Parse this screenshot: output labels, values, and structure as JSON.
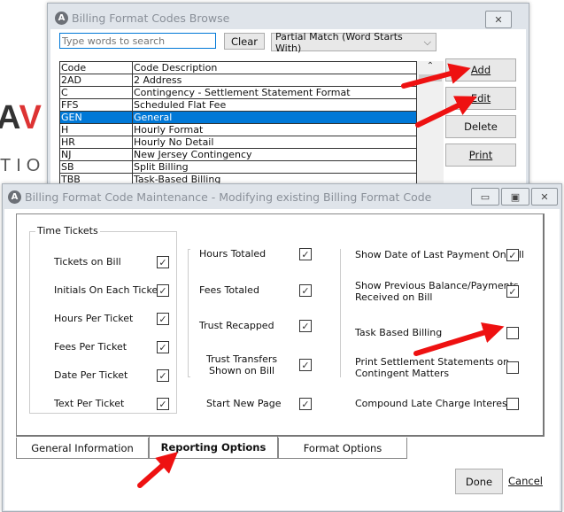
{
  "background_logo": {
    "top": "AV",
    "bottom": "TIO"
  },
  "browse": {
    "title": "Billing Format Codes Browse",
    "close_icon": "close-icon",
    "search_placeholder": "Type words to search",
    "clear_label": "Clear",
    "match_mode": "Partial Match (Word Starts With)",
    "columns": [
      "Code",
      "Code Description"
    ],
    "rows": [
      {
        "code": "2AD",
        "desc": "2 Address"
      },
      {
        "code": "C",
        "desc": "Contingency - Settlement Statement Format"
      },
      {
        "code": "FFS",
        "desc": "Scheduled Flat Fee"
      },
      {
        "code": "GEN",
        "desc": "General",
        "selected": true
      },
      {
        "code": "H",
        "desc": "Hourly Format"
      },
      {
        "code": "HR",
        "desc": "Hourly No Detail"
      },
      {
        "code": "NJ",
        "desc": "New Jersey Contingency"
      },
      {
        "code": "SB",
        "desc": "Split Billing"
      },
      {
        "code": "TBB",
        "desc": "Task-Based Billing"
      }
    ],
    "buttons": {
      "add": "Add",
      "edit": "Edit",
      "delete": "Delete",
      "print": "Print"
    }
  },
  "maint": {
    "title": "Billing Format Code Maintenance - Modifying existing Billing Format Code",
    "group_title": "Time Tickets",
    "col1": [
      {
        "label": "Tickets on Bill",
        "checked": true
      },
      {
        "label": "Initials On Each Ticket",
        "checked": true
      },
      {
        "label": "Hours Per Ticket",
        "checked": true
      },
      {
        "label": "Fees Per Ticket",
        "checked": true
      },
      {
        "label": "Date Per Ticket",
        "checked": true
      },
      {
        "label": "Text Per Ticket",
        "checked": true
      }
    ],
    "col2": [
      {
        "label": "Hours Totaled",
        "checked": true
      },
      {
        "label": "Fees Totaled",
        "checked": true
      },
      {
        "label": "Trust Recapped",
        "checked": true
      },
      {
        "label": "Trust Transfers\nShown on Bill",
        "checked": true
      },
      {
        "label": "Start New Page",
        "checked": true
      }
    ],
    "col3": [
      {
        "label": "Show Date of Last Payment On Bill",
        "checked": true
      },
      {
        "label": "Show Previous Balance/Payments\nReceived on Bill",
        "checked": true
      },
      {
        "label": "Task Based Billing",
        "checked": false
      },
      {
        "label": "Print Settlement Statements on\nContingent Matters",
        "checked": false
      },
      {
        "label": "Compound Late Charge Interest",
        "checked": false
      }
    ],
    "tabs": [
      "General Information",
      "Reporting Options",
      "Format Options"
    ],
    "active_tab": "Reporting Options",
    "done": "Done",
    "cancel": "Cancel"
  }
}
